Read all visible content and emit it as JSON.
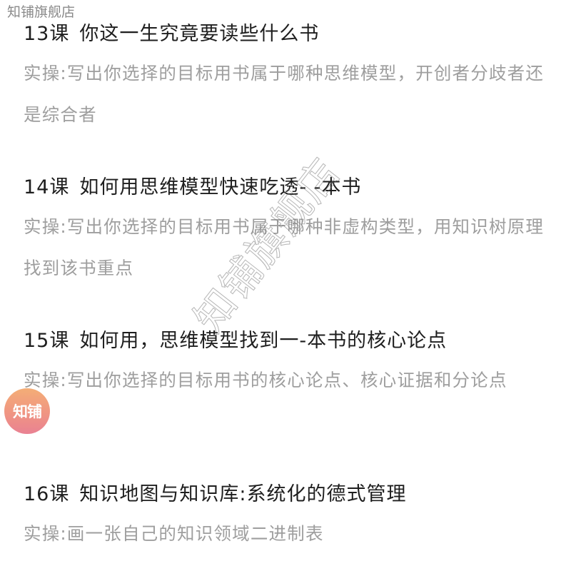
{
  "store_watermark": "知铺旗舰店",
  "diagonal_watermark": "知铺旗舰店",
  "badge": {
    "label": "知铺",
    "colors": [
      "#f3a76b",
      "#e8778a"
    ]
  },
  "lessons": [
    {
      "number": "13课",
      "title": "你这一生究竟要读些什么书",
      "practice": "实操:写出你选择的目标用书属于哪种思维模型，开创者分歧者还是综合者"
    },
    {
      "number": "14课",
      "title": "如何用思维模型快速吃透- -本书",
      "practice": "实操:写出你选择的目标用书属于哪种非虚构类型，用知识树原理找到该书重点"
    },
    {
      "number": "15课",
      "title": "如何用，思维模型找到一-本书的核心论点",
      "practice": "实操:写出你选择的目标用书的核心论点、核心证据和分论点"
    },
    {
      "number": "16课",
      "title": "知识地图与知识库:系统化的德式管理",
      "practice": "实操:画一张自己的知识领域二进制表"
    }
  ]
}
